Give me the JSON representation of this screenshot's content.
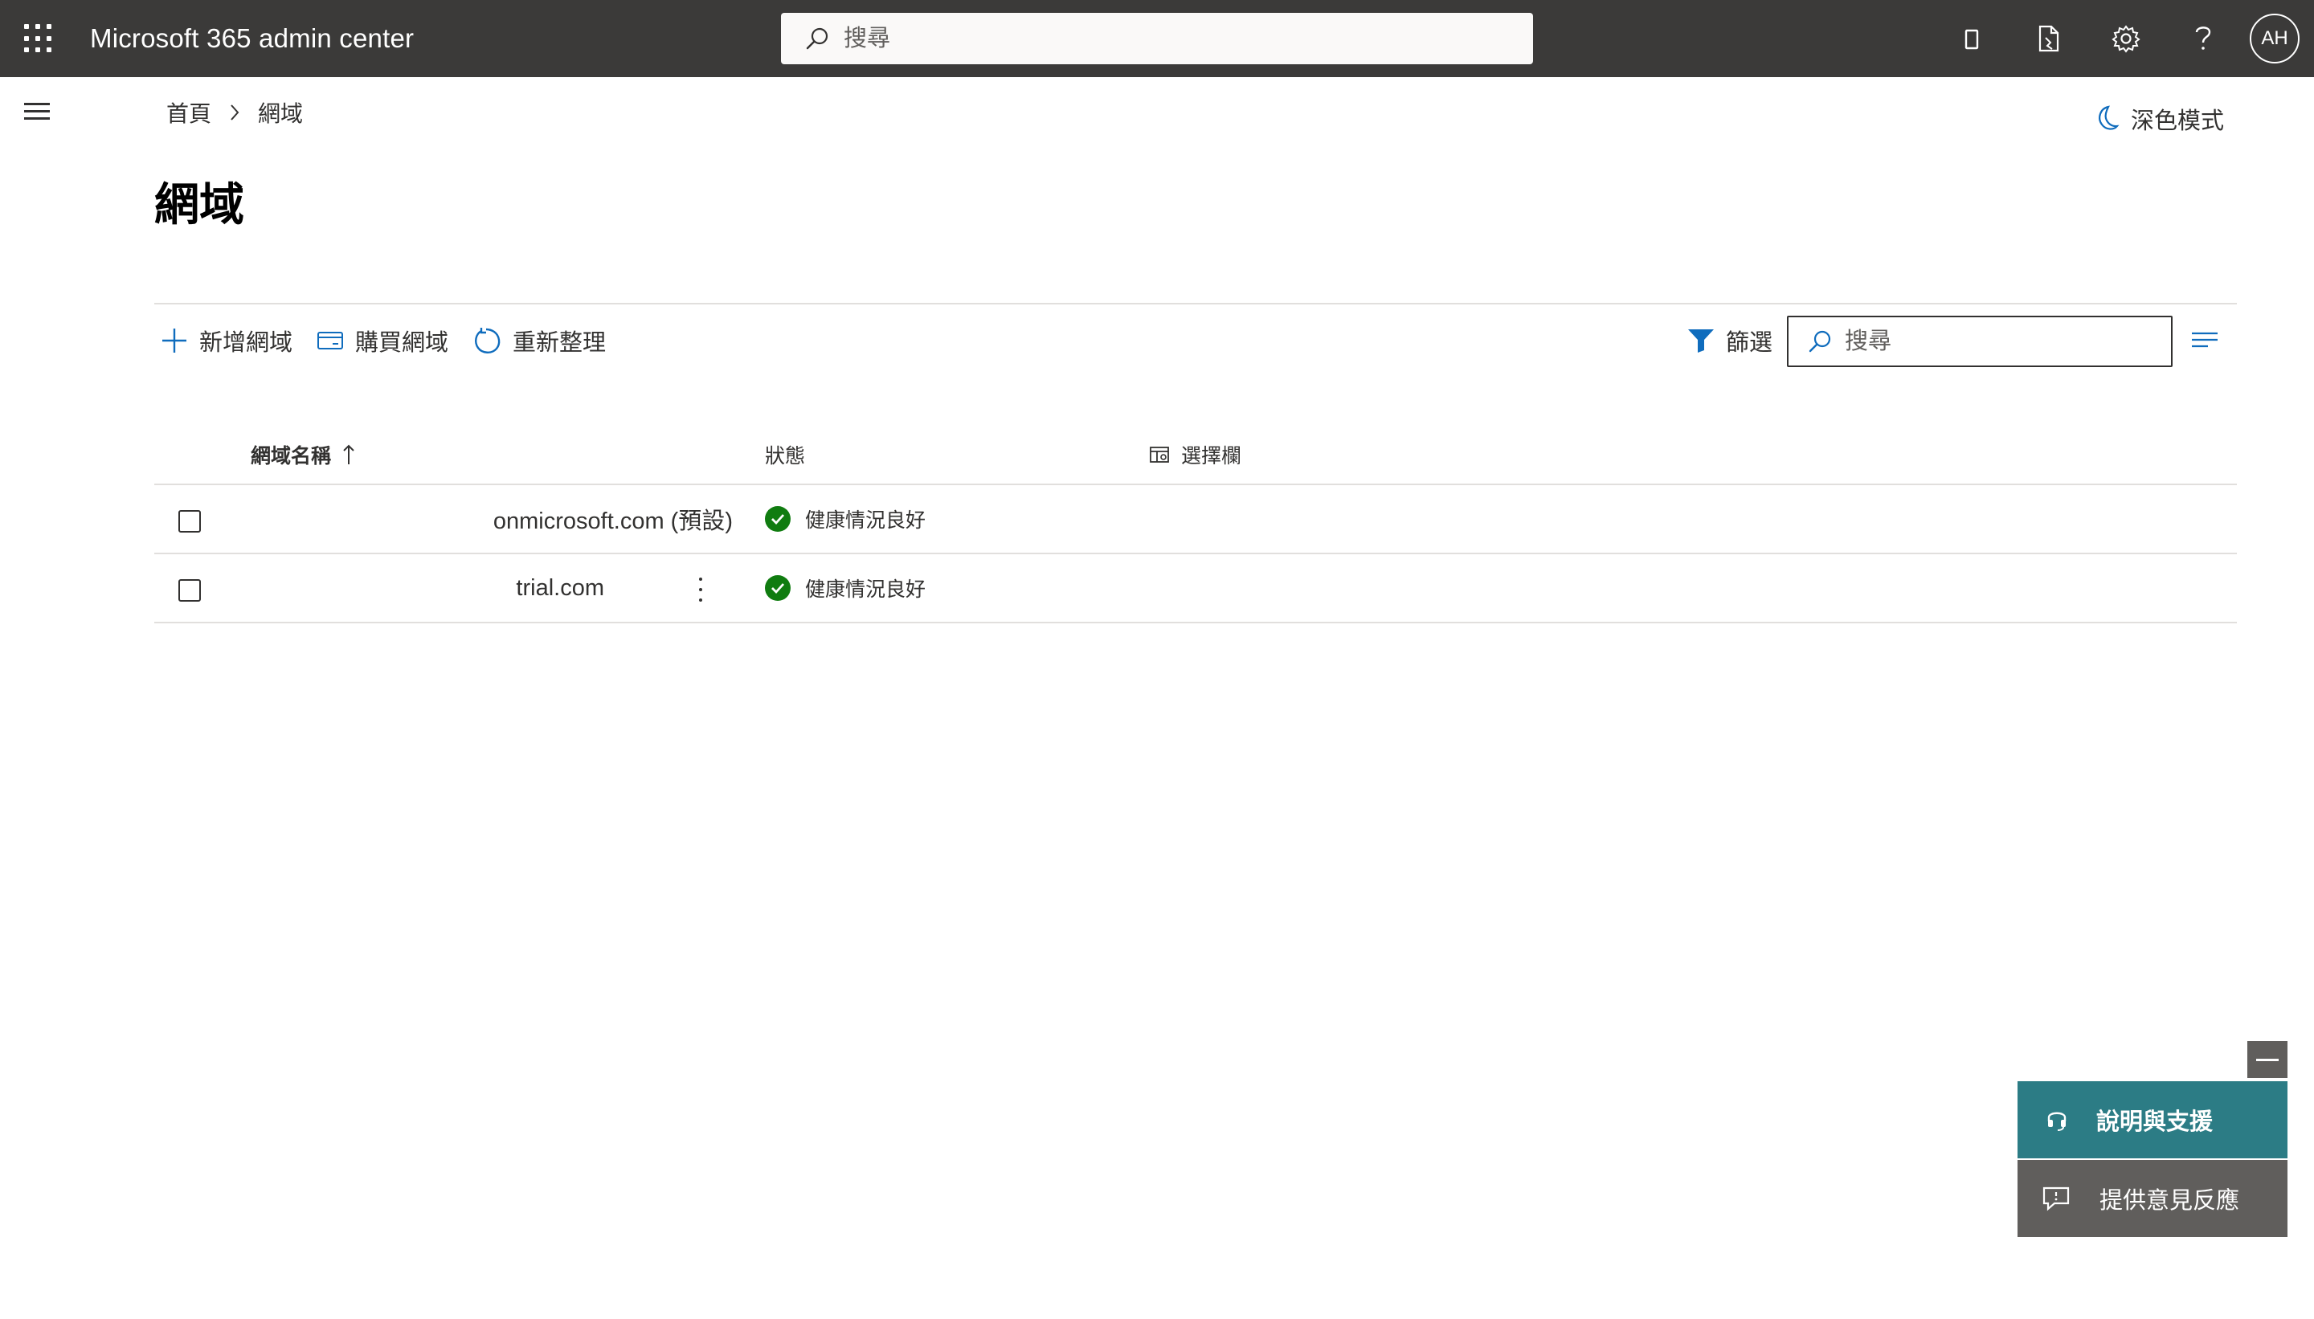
{
  "app": {
    "title": "Microsoft 365 admin center"
  },
  "topbar": {
    "search_placeholder": "搜尋",
    "icons": [
      "mobile-icon",
      "document-icon",
      "settings-icon",
      "help-icon"
    ],
    "avatar_initials": "AH"
  },
  "breadcrumb": {
    "home": "首頁",
    "current": "網域"
  },
  "dark_mode_label": "深色模式",
  "page_title": "網域",
  "commands": {
    "add_domain": "新增網域",
    "buy_domain": "購買網域",
    "refresh": "重新整理",
    "filter": "篩選",
    "search_placeholder": "搜尋"
  },
  "table": {
    "headers": {
      "name": "網域名稱",
      "status": "狀態",
      "choose_columns": "選擇欄"
    },
    "rows": [
      {
        "name": "onmicrosoft.com (預設)",
        "status": "健康情況良好"
      },
      {
        "name": "trial.com",
        "status": "健康情況良好"
      }
    ]
  },
  "help_panel": {
    "help_support": "說明與支援",
    "feedback": "提供意見反應"
  },
  "colors": {
    "topbar": "#3b3a39",
    "accent": "#2c7c85",
    "status_ok": "#107c10",
    "link_blue": "#0f6cbd"
  }
}
